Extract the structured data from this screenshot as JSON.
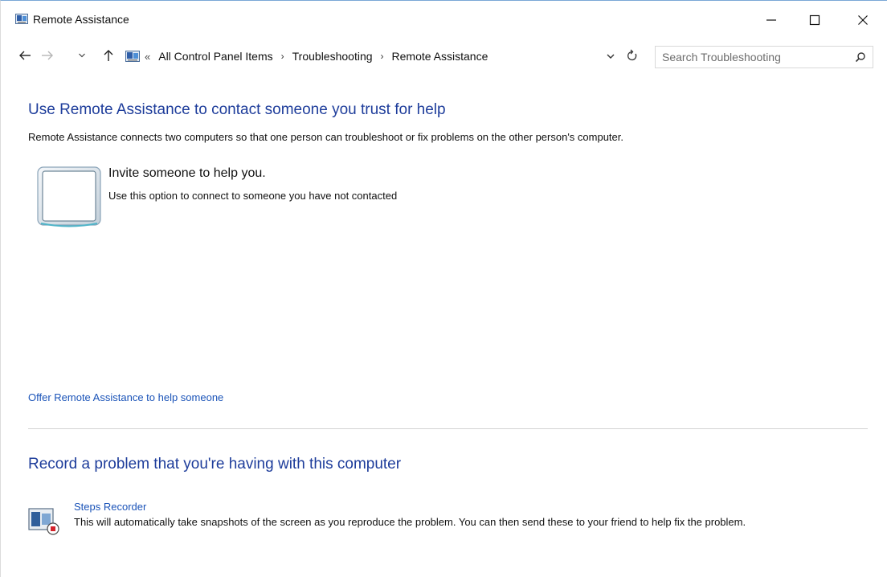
{
  "window": {
    "title": "Remote Assistance",
    "app_icon": "remote-assistance-icon",
    "controls": {
      "minimize": "minimize-icon",
      "maximize": "maximize-icon",
      "close": "close-icon"
    }
  },
  "navigation": {
    "back_icon": "back-arrow-icon",
    "forward_icon": "forward-arrow-icon",
    "recent_icon": "chevron-down-icon",
    "up_icon": "up-arrow-icon",
    "overflow": "«",
    "breadcrumbs": [
      {
        "label": "All Control Panel Items"
      },
      {
        "label": "Troubleshooting"
      },
      {
        "label": "Remote Assistance"
      }
    ],
    "separator": "›",
    "search_placeholder": "Search Troubleshooting"
  },
  "main": {
    "heading": "Use Remote Assistance to contact someone you trust for help",
    "description": "Remote Assistance connects two computers so that one person can troubleshoot or fix problems on the other person's computer.",
    "invite": {
      "title": "Invite someone to help you.",
      "subtitle": "Use this option to connect to someone you have not contacted"
    },
    "offer_link": "Offer Remote Assistance to help someone"
  },
  "record": {
    "heading": "Record a problem that you're having with this computer",
    "steps_link": "Steps Recorder",
    "steps_description": "This will automatically take snapshots of the screen as you reproduce the problem. You can then send these to your friend to help fix the problem."
  },
  "colors": {
    "heading": "#1e3d9b",
    "link": "#1a53b8",
    "window_border": "#7aa7d6"
  }
}
